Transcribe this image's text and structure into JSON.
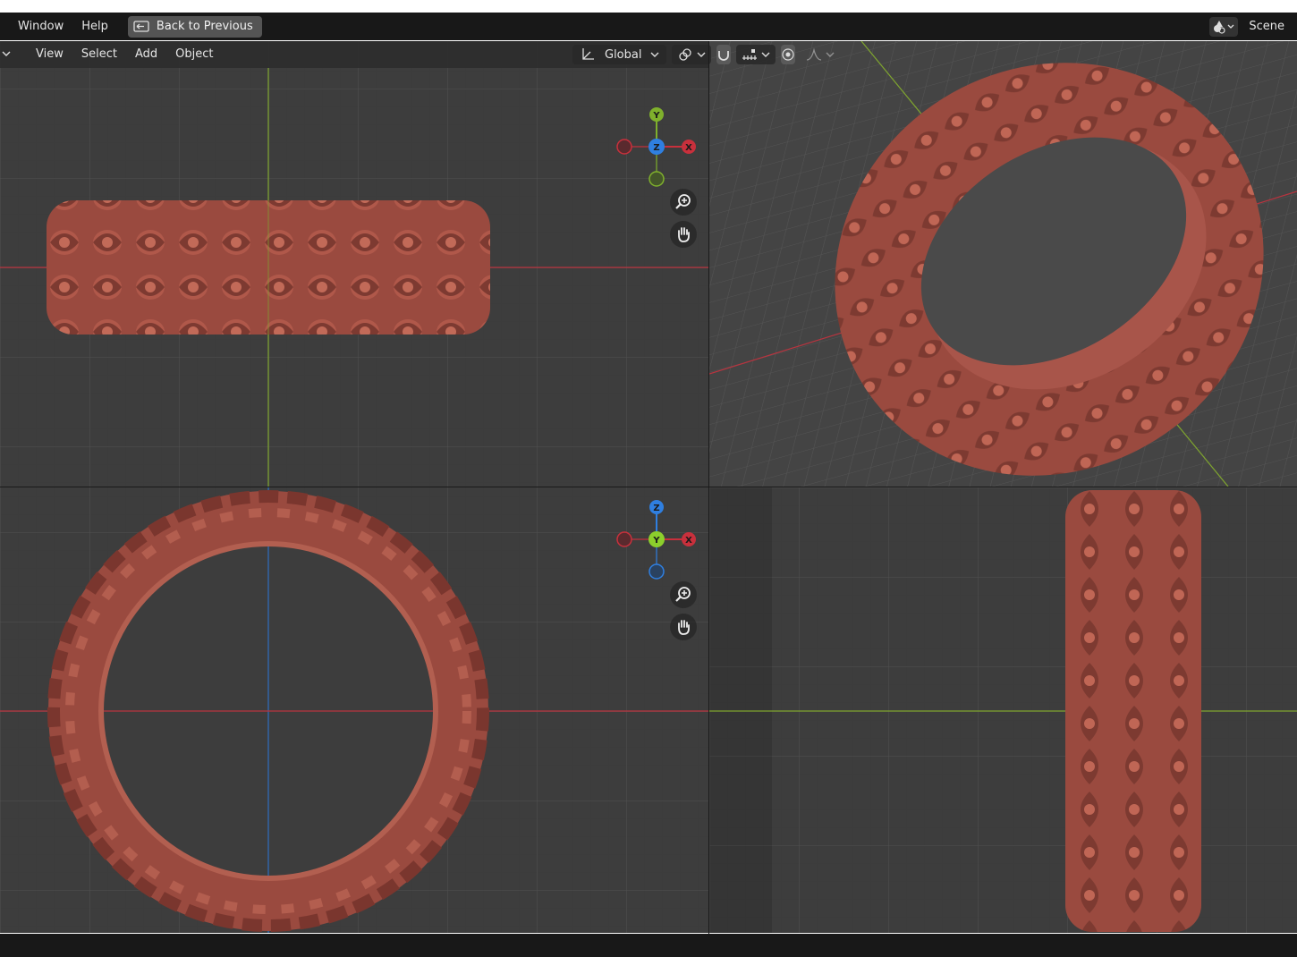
{
  "topbar": {
    "menus": [
      {
        "label": "Window"
      },
      {
        "label": "Help"
      }
    ],
    "back_button": "Back to Previous",
    "scene_label": "Scene"
  },
  "viewport_header": {
    "menus": [
      {
        "label": "View"
      },
      {
        "label": "Select"
      },
      {
        "label": "Add"
      },
      {
        "label": "Object"
      }
    ],
    "transform_orientation": "Global"
  },
  "gizmos": {
    "front": {
      "up": "Y",
      "center": "Z",
      "right": "X"
    },
    "top": {
      "up": "Z",
      "center": "Y",
      "right": "X"
    }
  },
  "colors": {
    "axis_x": "#c8303c",
    "axis_y": "#7fb02c",
    "axis_z": "#2f7fe0",
    "ring": "#9c4a40"
  }
}
